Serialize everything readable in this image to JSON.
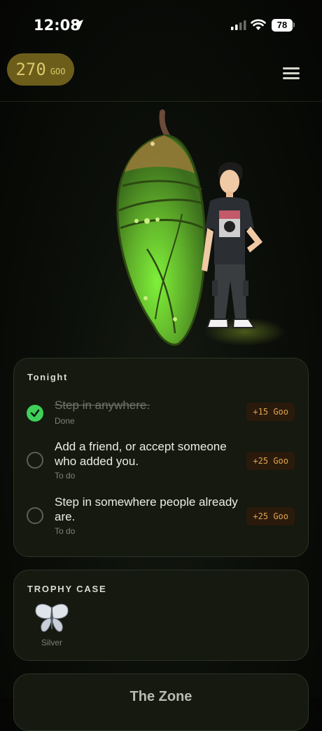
{
  "status": {
    "time": "12:08",
    "battery": "78"
  },
  "header": {
    "goo_amount": "270",
    "goo_unit": "GOO"
  },
  "tonight": {
    "title": "Tonight",
    "tasks": [
      {
        "title": "Step in anywhere.",
        "status": "Done",
        "reward": "+15 Goo",
        "done": true
      },
      {
        "title": "Add a friend, or accept someone who added you.",
        "status": "To do",
        "reward": "+25 Goo",
        "done": false
      },
      {
        "title": "Step in somewhere people already are.",
        "status": "To do",
        "reward": "+25 Goo",
        "done": false
      }
    ]
  },
  "trophy_case": {
    "title": "TROPHY CASE",
    "items": [
      {
        "name": "Silver",
        "icon": "butterfly-icon"
      }
    ]
  },
  "zone": {
    "title": "The Zone"
  },
  "colors": {
    "accent_green": "#3fd05a",
    "goo_pill": "#6d5d1a",
    "reward_text": "#e0a64d"
  }
}
